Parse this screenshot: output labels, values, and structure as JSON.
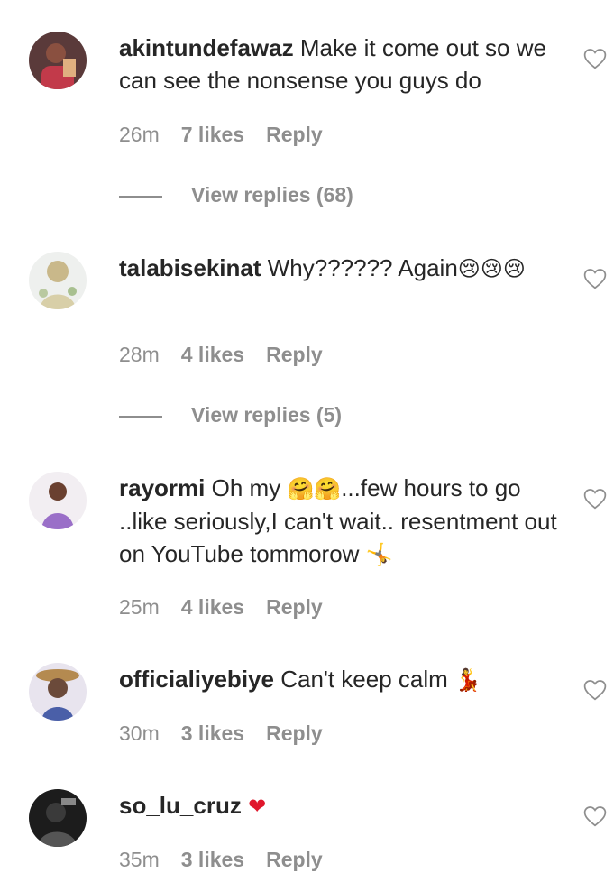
{
  "comments": [
    {
      "username": "akintundefawaz",
      "text": "Make it come out so we can see the nonsense you guys do",
      "emoji": "",
      "time": "26m",
      "likes": "7 likes",
      "reply": "Reply",
      "view_replies": "View replies (68)"
    },
    {
      "username": "talabisekinat",
      "text": "Why?????? Again",
      "emoji": "😢😢😢",
      "time": "28m",
      "likes": "4 likes",
      "reply": "Reply",
      "view_replies": "View replies (5)"
    },
    {
      "username": "rayormi",
      "text_a": "Oh my",
      "emoji_a": "🤗🤗",
      "text_b": "...few hours to go ..like seriously,I can't wait.. resentment out on YouTube tommorow",
      "emoji_b": "🤸",
      "time": "25m",
      "likes": "4 likes",
      "reply": "Reply"
    },
    {
      "username": "officialiyebiye",
      "text": "Can't keep calm",
      "emoji": "💃",
      "time": "30m",
      "likes": "3 likes",
      "reply": "Reply"
    },
    {
      "username": "so_lu_cruz",
      "text": "",
      "emoji": "❤",
      "time": "35m",
      "likes": "3 likes",
      "reply": "Reply"
    }
  ],
  "icons": {
    "like": "heart-outline-icon",
    "avatar": "user-avatar"
  },
  "colors": {
    "text": "#262626",
    "meta": "#8e8e8e",
    "heart_red": "#e0162b"
  }
}
